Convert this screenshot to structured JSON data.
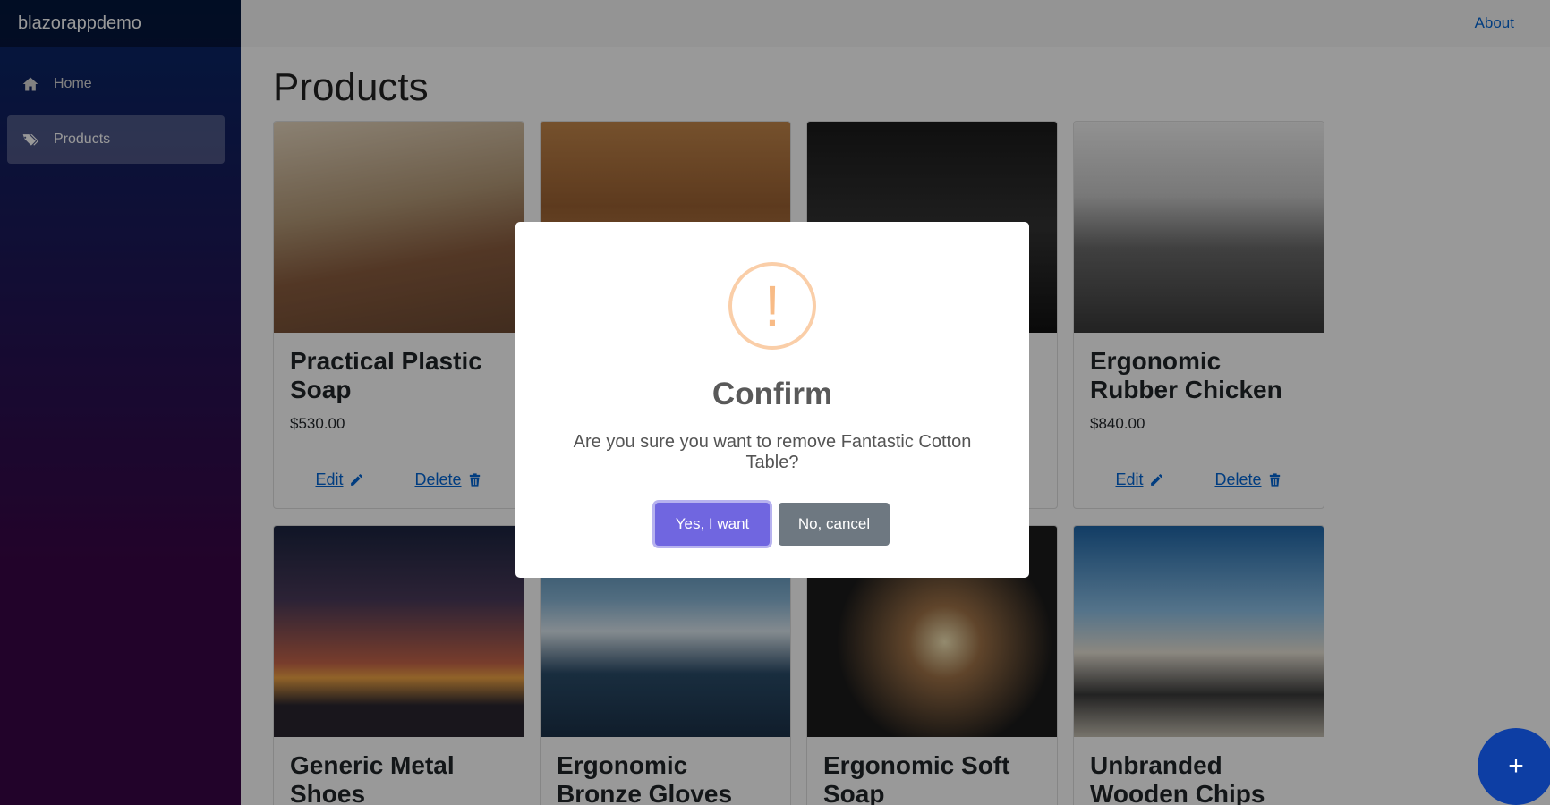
{
  "brand": "blazorappdemo",
  "nav": {
    "items": [
      {
        "label": "Home",
        "icon": "home-icon"
      },
      {
        "label": "Products",
        "icon": "tags-icon"
      }
    ]
  },
  "top": {
    "about": "About"
  },
  "page": {
    "title": "Products"
  },
  "products": [
    {
      "title": "Practical Plastic Soap",
      "price": "$530.00",
      "edit": "Edit",
      "delete": "Delete"
    },
    {
      "title": "",
      "price": "",
      "edit": "",
      "delete": ""
    },
    {
      "title": "",
      "price": "",
      "edit": "",
      "delete": ""
    },
    {
      "title": "Ergonomic Rubber Chicken",
      "price": "$840.00",
      "edit": "Edit",
      "delete": "Delete"
    },
    {
      "title": "Generic Metal Shoes"
    },
    {
      "title": "Ergonomic Bronze Gloves"
    },
    {
      "title": "Ergonomic Soft Soap"
    },
    {
      "title": "Unbranded Wooden Chips"
    }
  ],
  "fab": {
    "label": "+"
  },
  "modal": {
    "icon": "!",
    "title": "Confirm",
    "text": "Are you sure you want to remove Fantastic Cotton Table?",
    "confirm": "Yes, I want",
    "cancel": "No, cancel"
  },
  "colors": {
    "confirm": "#7066e0",
    "cancel": "#6e7881",
    "warning": "#f8bb86",
    "link": "#0366d6"
  }
}
